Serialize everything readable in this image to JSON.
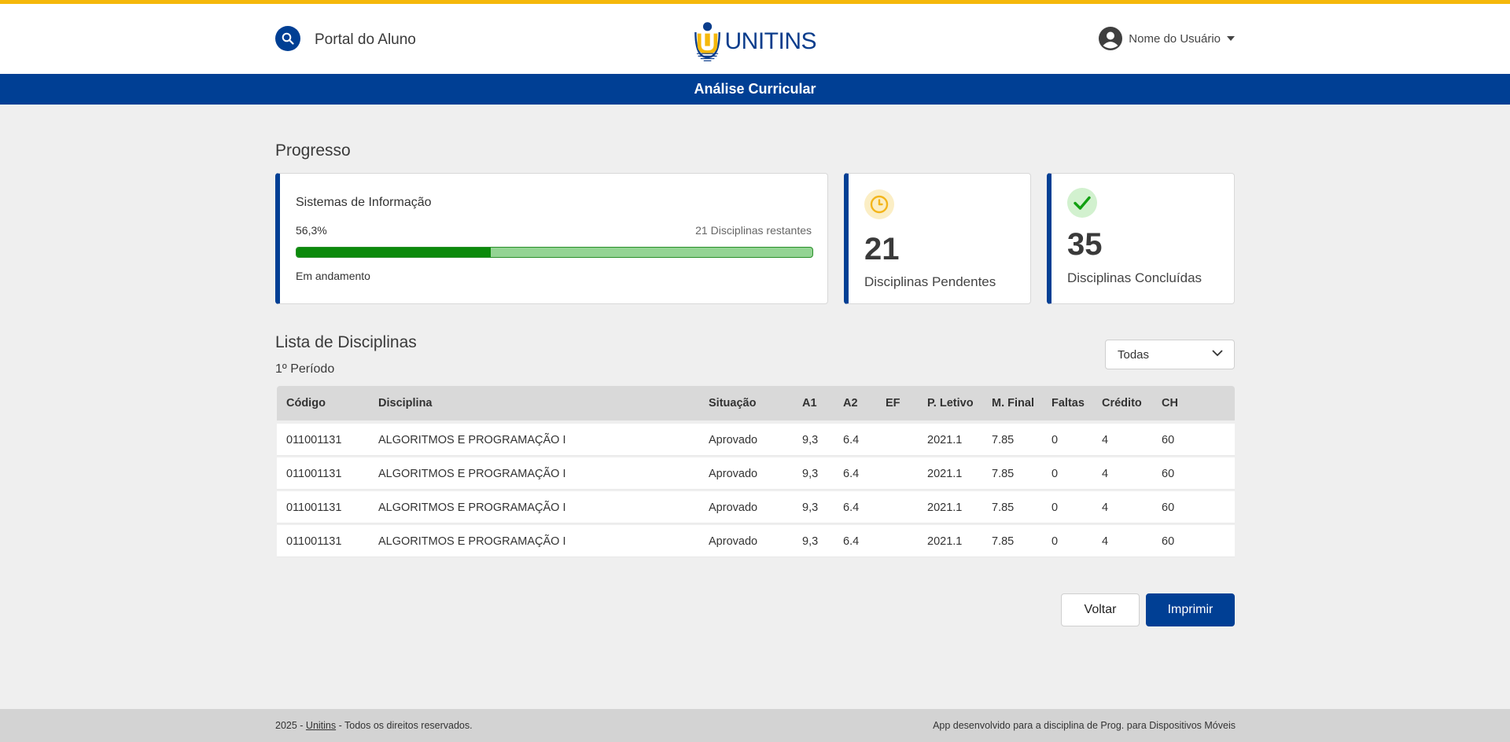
{
  "colors": {
    "accent": "#003f94",
    "top_stripe": "#f5b80b",
    "progress": "#0b8a0b",
    "progress_track": "#93d493",
    "pending": "#f3b51b",
    "done": "#12a012"
  },
  "header": {
    "portal_title": "Portal do Aluno",
    "logo_text": "UNITINS",
    "user_name": "Nome do Usuário",
    "icons": {
      "search": "search-icon",
      "user": "user-circle-icon",
      "dropdown": "caret-down-icon"
    }
  },
  "page_title": "Análise Curricular",
  "progress": {
    "section_title": "Progresso",
    "course": {
      "name": "Sistemas de Informação",
      "percent_label": "56,3%",
      "bar_fraction": 0.376,
      "remaining": "21 Disciplinas restantes",
      "status": "Em andamento"
    },
    "pending": {
      "count": "21",
      "label": "Disciplinas Pendentes",
      "icon": "clock-icon"
    },
    "done": {
      "count": "35",
      "label": "Disciplinas Concluídas",
      "icon": "check-icon"
    }
  },
  "disciplines": {
    "section_title": "Lista de Disciplinas",
    "period": "1º Período",
    "filter": {
      "selected": "Todas"
    },
    "columns": [
      "Código",
      "Disciplina",
      "Situação",
      "A1",
      "A2",
      "EF",
      "P. Letivo",
      "M. Final",
      "Faltas",
      "Crédito",
      "CH"
    ],
    "rows": [
      [
        "011001131",
        "ALGORITMOS E PROGRAMAÇÃO I",
        "Aprovado",
        "9,3",
        "6.4",
        "",
        "2021.1",
        "7.85",
        "0",
        "4",
        "60"
      ],
      [
        "011001131",
        "ALGORITMOS E PROGRAMAÇÃO I",
        "Aprovado",
        "9,3",
        "6.4",
        "",
        "2021.1",
        "7.85",
        "0",
        "4",
        "60"
      ],
      [
        "011001131",
        "ALGORITMOS E PROGRAMAÇÃO I",
        "Aprovado",
        "9,3",
        "6.4",
        "",
        "2021.1",
        "7.85",
        "0",
        "4",
        "60"
      ],
      [
        "011001131",
        "ALGORITMOS E PROGRAMAÇÃO I",
        "Aprovado",
        "9,3",
        "6.4",
        "",
        "2021.1",
        "7.85",
        "0",
        "4",
        "60"
      ]
    ]
  },
  "actions": {
    "back": "Voltar",
    "print": "Imprimir"
  },
  "footer": {
    "year_prefix": "2025 - ",
    "link": "Unitins",
    "rights": " - Todos os direitos reservados.",
    "right_text": "App desenvolvido para a disciplina de Prog. para Dispositivos Móveis"
  }
}
